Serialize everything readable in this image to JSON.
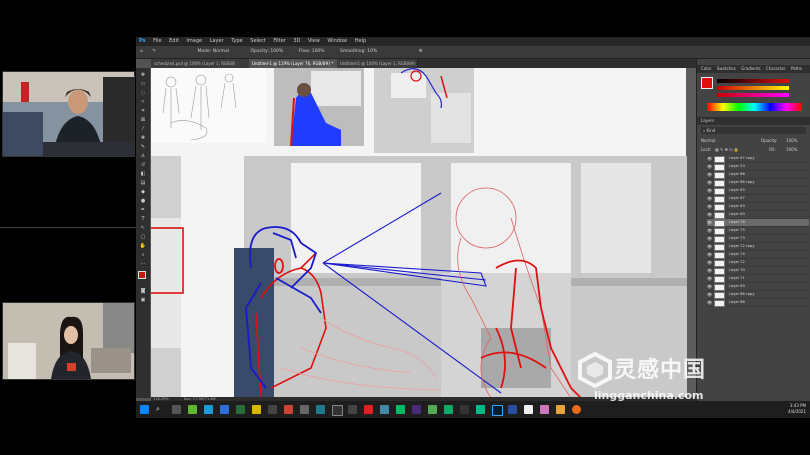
{
  "menu": [
    "File",
    "Edit",
    "Image",
    "Layer",
    "Type",
    "Select",
    "Filter",
    "3D",
    "View",
    "Window",
    "Help"
  ],
  "options_bar": {
    "mode_label": "Mode:",
    "mode_value": "Normal",
    "opacity_label": "Opacity:",
    "opacity_value": "100%",
    "flow_label": "Flow:",
    "flow_value": "100%",
    "smoothing_label": "Smoothing:",
    "smoothing_value": "10%"
  },
  "tabs": [
    {
      "label": "schedule4.psd @ 100% (Layer 1, RGB/8)",
      "active": false
    },
    {
      "label": "Untitled-1 @ 119% (Layer 76, RGB/8#) *",
      "active": true
    },
    {
      "label": "Untitled-2 @ 100% (Layer 1, RGB/8#)",
      "active": false
    }
  ],
  "status": {
    "zoom": "118.29%",
    "doc": "Doc: 17.9M/71.6M"
  },
  "color_panel_tabs": [
    "Color",
    "Swatches",
    "Gradients",
    "Character",
    "Paths"
  ],
  "layers_panel": {
    "tabs": [
      "Layers"
    ],
    "kind_label": "Kind",
    "blend": "Normal",
    "opacity_label": "Opacity:",
    "opacity_value": "100%",
    "lock_label": "Lock:",
    "fill_label": "Fill:",
    "fill_value": "100%",
    "layers": [
      "Layer 67 copy",
      "Layer 53",
      "Layer 66",
      "Layer 68 copy",
      "Layer 65",
      "Layer 67",
      "Layer 63",
      "Layer 60",
      "Layer 76",
      "Layer 75",
      "Layer 73",
      "Layer 72 copy",
      "Layer 74",
      "Layer 72",
      "Layer 70",
      "Layer 71",
      "Layer 69",
      "Layer 68 copy",
      "Layer 68"
    ],
    "selected_index": 8
  },
  "clock": {
    "time": "3:43 PM",
    "date": "4/4/2021"
  },
  "watermark": {
    "text": "灵感中国",
    "url": "lingganchina.com"
  },
  "colors": {
    "accent_red": "#e01010",
    "accent_blue": "#1a1aff",
    "foreground": "#cc1111",
    "background_swatch": "#ffffff"
  }
}
